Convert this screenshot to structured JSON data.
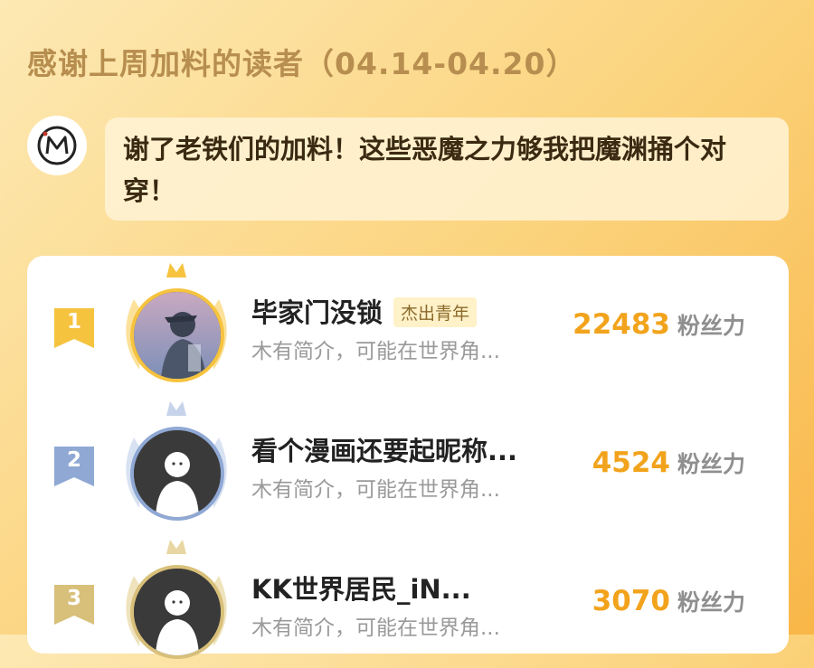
{
  "header": {
    "title": "感谢上周加料的读者（04.14-04.20）"
  },
  "author": {
    "avatar_icon": "author-logo-icon",
    "message": "谢了老铁们的加料！这些恶魔之力够我把魔渊捅个对穿！"
  },
  "leaderboard": {
    "fans_unit": "粉丝力",
    "items": [
      {
        "rank": "1",
        "name": "毕家门没锁",
        "badge": "杰出青年",
        "bio": "木有简介，可能在世界角...",
        "fans": "22483",
        "medal_color": "#f6c33f"
      },
      {
        "rank": "2",
        "name": "看个漫画还要起昵称...",
        "badge": "",
        "bio": "木有简介，可能在世界角...",
        "fans": "4524",
        "medal_color": "#8fa8d4"
      },
      {
        "rank": "3",
        "name": "KK世界居民_iN...",
        "badge": "",
        "bio": "木有简介，可能在世界角...",
        "fans": "3070",
        "medal_color": "#d8c07a"
      }
    ]
  }
}
